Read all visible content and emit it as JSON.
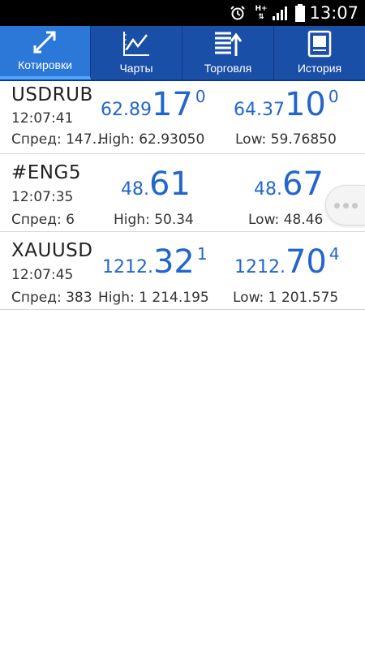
{
  "status_bar": {
    "time": "13:07",
    "network": "H+",
    "icons": [
      "alarm-icon",
      "network-hplus-icon",
      "signal-icon",
      "battery-icon"
    ]
  },
  "tabs": [
    {
      "label": "Котировки",
      "icon": "quotes-arrows-icon",
      "active": true
    },
    {
      "label": "Чарты",
      "icon": "chart-icon",
      "active": false
    },
    {
      "label": "Торговля",
      "icon": "trade-list-icon",
      "active": false
    },
    {
      "label": "История",
      "icon": "history-journal-icon",
      "active": false
    }
  ],
  "quotes": [
    {
      "symbol": "USDRUB",
      "time": "12:07:41",
      "bid": {
        "prefix": "62.89",
        "big": "17",
        "sup": "0"
      },
      "ask": {
        "prefix": "64.37",
        "big": "10",
        "sup": "0"
      },
      "spread": "Спред: 147…",
      "high": "High: 62.93050",
      "low": "Low: 59.76850"
    },
    {
      "symbol": "#ENG5",
      "time": "12:07:35",
      "bid": {
        "prefix": "48.",
        "big": "61",
        "sup": ""
      },
      "ask": {
        "prefix": "48.",
        "big": "67",
        "sup": ""
      },
      "spread": "Спред: 6",
      "high": "High: 50.34",
      "low": "Low: 48.46"
    },
    {
      "symbol": "XAUUSD",
      "time": "12:07:45",
      "bid": {
        "prefix": "1212.",
        "big": "32",
        "sup": "1"
      },
      "ask": {
        "prefix": "1212.",
        "big": "70",
        "sup": "4"
      },
      "spread": "Спред: 383",
      "high": "High: 1 214.195",
      "low": "Low: 1 201.575"
    }
  ],
  "colors": {
    "tabbar": "#1a4fa8",
    "tab_active": "#2b78d9",
    "price": "#2266cc"
  }
}
